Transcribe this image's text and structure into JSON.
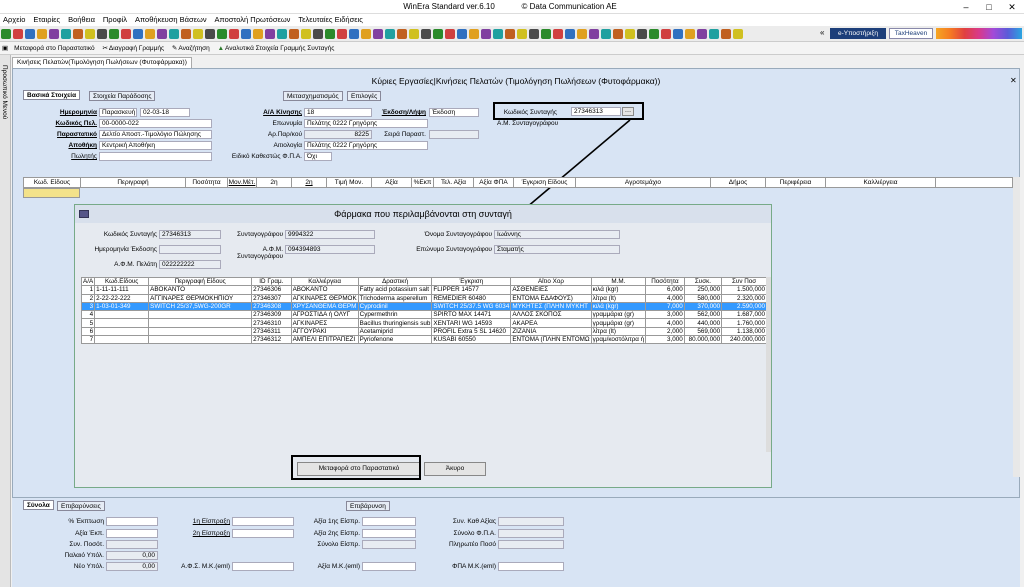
{
  "window": {
    "title": "WinEra Standard ver.6.10",
    "company": "© Data Communication AE"
  },
  "menu": [
    "Αρχείο",
    "Εταιρίες",
    "Βοήθεια",
    "Προφίλ",
    "Αποθήκευση Βάσεων",
    "Αποστολή Πρωτόσεων",
    "Τελευταίες Ειδήσεις"
  ],
  "toolbar1": {
    "support": "e-Υποστήριξη",
    "taxheaven": "TaxHeaven"
  },
  "toolbar2": [
    "Μεταφορά στο Παραστατικό",
    "Διαγραφή Γραμμής",
    "Αναζήτηση",
    "Αναλυτικά Στοιχεία Γραμμής Συνταγής"
  ],
  "sidebar": {
    "label": "Προσωπικό Μενού"
  },
  "doc_tab": "Κινήσεις Πελατών(Τιμολόγηση Πωλήσεων (Φυτοφάρμακα))",
  "header": {
    "title": "Κύριες Εργασίες|Κινήσεις Πελατών (Τιμολόγηση Πωλήσεων (Φυτοφάρμακα))"
  },
  "tabs": {
    "basic": "Βασικά Στοιχεία",
    "extra": "Στοιχεία Παράδοσης",
    "transform": "Μετασχηματισμός",
    "options": "Επιλογές"
  },
  "form": {
    "date_label": "Ημερομηνία",
    "date_type": "Παρασκευή",
    "date": "02-03-18",
    "customer_code_label": "Κωδικός Πελ.",
    "customer_code": "00-0000-022",
    "doc_label": "Παραστατικό",
    "doc": "Δελτίο Αποστ.-Τιμολόγιο Πώλησης",
    "warehouse_label": "Αποθήκη",
    "warehouse": "Κεντρική Αποθήκη",
    "seller_label": "Πωλητής",
    "aa_label": "Α/Α Κίνησης",
    "aa": "18",
    "name_label": "Επωνυμία",
    "name": "Πελάτης 0222 Γρηγόρης",
    "ar_label": "Αρ.Παρ/κού",
    "ar": "8225",
    "series_label": "Σειρά Παραστ.",
    "reason_label": "Αιτιολογία",
    "reason": "Πελάτης 0222 Γρηγόρης",
    "vat_label": "Ειδικό Καθεστώς Φ.Π.Α.",
    "vat": "Όχι",
    "issue_label": "Έκδοση/Λήψη",
    "issue": "Έκδοση",
    "prescription_label": "Κωδικός Συνταγής",
    "prescription": "27346313",
    "agro_afm_label": "Α.Μ. Συνταγογράφου"
  },
  "grid_headers": [
    "Κωδ. Είδους",
    "Περιγραφή",
    "Ποσότητα",
    "Μον.Μέτ.",
    "2η Ποσότητα",
    "2η Μον.Μέτ.",
    "Τιμή Μον.",
    "Αξία",
    "%Εκπ",
    "Τελ. Αξία",
    "Αξία ΦΠΑ",
    "Έγκριση Είδους",
    "Αγροτεμάχιο",
    "Δήμος",
    "Περιφέρεια",
    "Καλλιέργεια"
  ],
  "dialog": {
    "title": "Φάρμακα που περιλαμβάνονται στη συνταγή",
    "code_label": "Κωδικός Συνταγής",
    "code": "27346313",
    "prescriber_label": "Συνταγογράφου",
    "prescriber": "9994322",
    "pname_label": "Όνομα Συνταγογράφου",
    "pname": "Ιωάννης",
    "issue_date_label": "Ημερομηνία Έκδοσης",
    "afm_label": "Α.Φ.Μ. Συνταγογράφου",
    "afm": "094394893",
    "surname_label": "Επώνυμο Συνταγογράφου",
    "surname": "Σταματής",
    "cust_afm_label": "Α.Φ.Μ. Πελάτη",
    "cust_afm": "022222222",
    "columns": [
      "Α/Α",
      "Κωδ.Είδους",
      "Περιγραφή Είδους",
      "ID Γραμ.",
      "Καλλιέργεια",
      "Δραστική",
      "Έγκριση",
      "Αίτιο Χορ",
      "Μ.Μ.",
      "Ποσότητα",
      "Συσκ.",
      "Συν Ποσ"
    ],
    "rows": [
      [
        "1",
        "1-11-11-111",
        "ΑΒΟΚΑΝΤΟ",
        "27346306",
        "ΑΒΟΚΑΝΤΟ",
        "Fatty acid potassium salt",
        "FLIPPER 14577",
        "ΑΣΘΕΝΕΙΕΣ",
        "κιλά (kgr)",
        "6,000",
        "250,000",
        "1.500,000"
      ],
      [
        "2",
        "2-22-22-222",
        "ΑΓΓΙΝΑΡΕΣ ΘΕΡΜΟΚΗΠΙΟΥ",
        "27346307",
        "ΑΓΚΙΝΑΡΕΣ ΘΕΡΜΟΚ",
        "Trichoderma asperellum",
        "REMEDIER 60480",
        "ΕΝΤΟΜΑ ΕΔΑΦΟΥΣ)",
        "λίτρα (lt)",
        "4,000",
        "580,000",
        "2.320,000"
      ],
      [
        "3",
        "1-03-01-349",
        "SWITCH 25/37,5WG-200GR",
        "27346308",
        "ΧΡΥΣΑΝΘΕΜΑ ΘΕΡΜ",
        "Cyprodinil",
        "SWITCH 25/37.5 WG 6034",
        "ΜΥΚΗΤΕΣ (ΠΛΗΝ ΜΥΚΗΤ",
        "κιλά (kgr)",
        "7,000",
        "370,000",
        "2.590,000"
      ],
      [
        "4",
        "",
        "",
        "27346309",
        "ΑΓΡΟΣΤΙΔΑ ή ΟΛΥΓ",
        "Cypermethrin",
        "SPIRTO MAX 14471",
        "ΑΛΛΟΣ ΣΚΟΠΟΣ",
        "γραμμάρια (gr)",
        "3,000",
        "562,000",
        "1.687,000"
      ],
      [
        "5",
        "",
        "",
        "27346310",
        "ΑΓΚΙΝΑΡΕΣ",
        "Bacillus thuringiensis sub",
        "XENTARI WG 14593",
        "ΑΚΑΡΕΑ",
        "γραμμάρια (gr)",
        "4,000",
        "440,000",
        "1.760,000"
      ],
      [
        "6",
        "",
        "",
        "27346311",
        "ΑΓΓΟΥΡΑΚΙ",
        "Acetamiprid",
        "PROFIL Extra 5 SL 14620",
        "ΖΙΖΑΝΙΑ",
        "λίτρα (lt)",
        "2,000",
        "569,000",
        "1.138,000"
      ],
      [
        "7",
        "",
        "",
        "27346312",
        "ΑΜΠΕΛΙ ΕΠΙΤΡΑΠΕΖΙ",
        "Pyriofenone",
        "KUSABI 60550",
        "ΕΝΤΟΜΑ (ΠΛΗΝ ΕΝΤΟΜΩ",
        "γραμ/κοστόλιτρα ή",
        "3,000",
        "80.000,000",
        "240.000,000"
      ]
    ],
    "transfer_btn": "Μεταφορά στο Παραστατικό",
    "cancel_btn": "Άκυρο"
  },
  "bottom": {
    "tab_totals": "Σύνολα",
    "tab_charges": "Επιβαρύνσεις",
    "charges_btn": "Επιβάρυνση",
    "discount": "% Έκπτωση",
    "disc_value": "Αξία Έκπ.",
    "total_qty": "Συν. Ποσότ.",
    "old_bal": "Παλαιό Υπόλ.",
    "old_val": "0,00",
    "new_bal": "Νέο Υπόλ.",
    "new_val": "0,00",
    "inc1": "1η Είσπραξη",
    "inc2": "2η Είσπραξη",
    "afs": "Α.Φ.Σ. Μ.Κ.(eml)",
    "val1": "Αξία 1ης Είσπρ.",
    "val2": "Αξία 2ης Είσπρ.",
    "total_inc": "Σύνολο Είσπρ.",
    "mk": "Αξία Μ.Κ.(eml)",
    "net": "Συν. Καθ Αξίας",
    "vat": "Σύνολο Φ.Π.Α.",
    "pay": "Πληρωτέο Ποσό",
    "fpa_mk": "ΦΠΑ Μ.Κ.(eml)"
  }
}
